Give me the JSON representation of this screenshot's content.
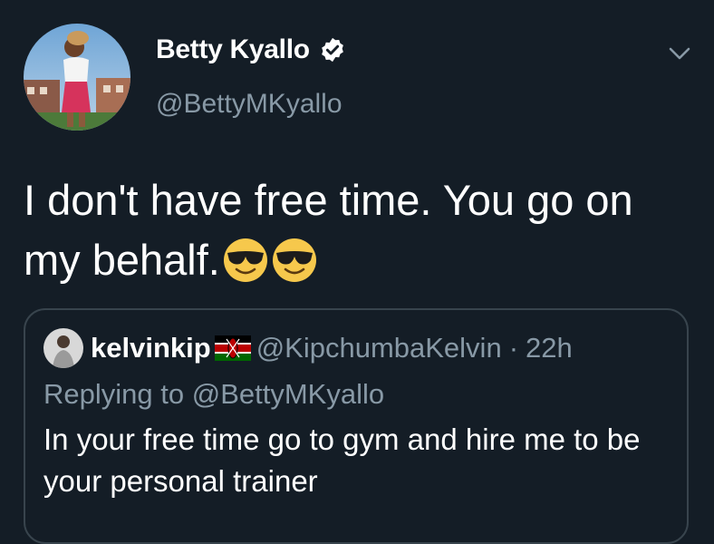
{
  "author": {
    "name": "Betty Kyallo",
    "handle": "@BettyMKyallo",
    "verified_icon": "verified-badge-icon"
  },
  "menu_icon": "chevron-down-icon",
  "tweet": {
    "text": "I don't have free time. You go on my behalf.",
    "emojis": [
      "sunglasses-face",
      "sunglasses-face"
    ]
  },
  "quoted": {
    "name": "kelvinkip",
    "flag_icon": "kenya-flag-icon",
    "handle": "@KipchumbaKelvin",
    "separator": "·",
    "time": "22h",
    "replying_to_label": "Replying to",
    "replying_to_handle": "@BettyMKyallo",
    "text": "In your free time go to gym and hire me to be your personal trainer"
  },
  "colors": {
    "background": "#141d26",
    "secondary_text": "#8899a6",
    "border": "#38444d"
  }
}
